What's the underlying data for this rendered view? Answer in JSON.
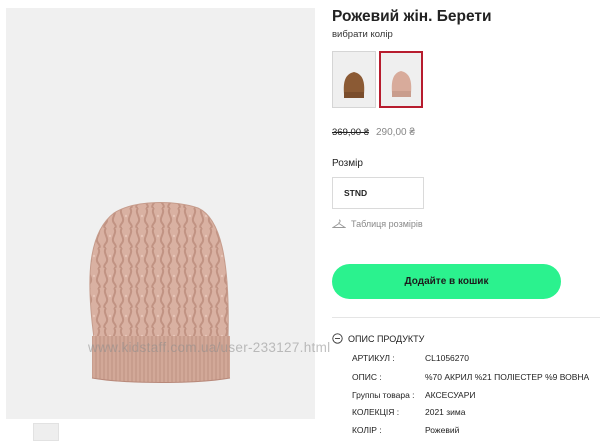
{
  "product": {
    "title": "Рожевий жін. Берети",
    "choose_color": "вибрати колір",
    "price_old": "369,00 ₴",
    "price_new": "290,00 ₴",
    "size_label": "Розмір",
    "size_option": "STND",
    "size_table_link": "Таблиця розмірів",
    "cart_button": "Додайте в кошик",
    "description_header": "ОПИС ПРОДУКТУ"
  },
  "swatches": [
    {
      "name": "brown",
      "color": "#8b5a34",
      "selected": false
    },
    {
      "name": "pink",
      "color": "#d8ab9b",
      "selected": true
    }
  ],
  "specs": [
    {
      "label": "АРТИКУЛ :",
      "value": "CL1056270"
    },
    {
      "label": "ОПИС :",
      "value": "%70 АКРИЛ %21 ПОЛІЕСТЕР %9 ВОВНА"
    },
    {
      "label": "Группы товара :",
      "value": "АКСЕСУАРИ"
    },
    {
      "label": "КОЛЕКЦІЯ :",
      "value": "2021 зима"
    },
    {
      "label": "КОЛІР :",
      "value": "Рожевий"
    }
  ],
  "watermark": "www.kidstaff.com.ua/user-233127.html",
  "colors": {
    "accent_green": "#2bf28e",
    "selected_border": "#b71c2e",
    "hat_pink": "#d9b1a2"
  },
  "icons": [
    "hanger-icon",
    "minus-circle-icon"
  ]
}
